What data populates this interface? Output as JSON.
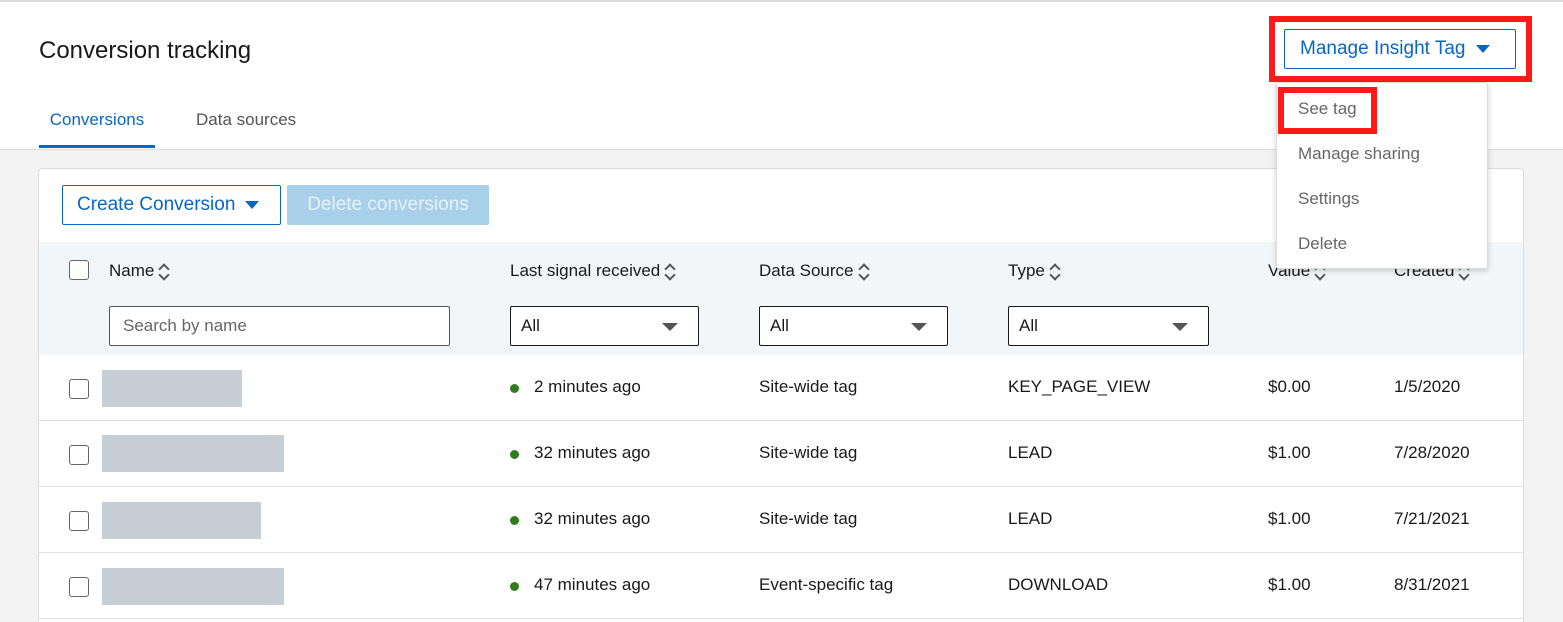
{
  "header": {
    "title": "Conversion tracking",
    "tabs": [
      {
        "label": "Conversions"
      },
      {
        "label": "Data sources"
      }
    ],
    "manage_label": "Manage Insight Tag"
  },
  "menu": {
    "items": [
      {
        "label": "See tag"
      },
      {
        "label": "Manage sharing"
      },
      {
        "label": "Settings"
      },
      {
        "label": "Delete"
      }
    ]
  },
  "toolbar": {
    "create_label": "Create Conversion",
    "delete_label": "Delete conversions"
  },
  "table": {
    "columns": [
      {
        "label": "Name"
      },
      {
        "label": "Last signal received"
      },
      {
        "label": "Data Source"
      },
      {
        "label": "Type"
      },
      {
        "label": "Value"
      },
      {
        "label": "Created"
      }
    ],
    "search_placeholder": "Search by name",
    "filters": [
      {
        "value": "All"
      },
      {
        "value": "All"
      },
      {
        "value": "All"
      }
    ],
    "rows": [
      {
        "last": "2 minutes ago",
        "source": "Site-wide tag",
        "type": "KEY_PAGE_VIEW",
        "value": "$0.00",
        "created": "1/5/2020"
      },
      {
        "last": "32 minutes ago",
        "source": "Site-wide tag",
        "type": "LEAD",
        "value": "$1.00",
        "created": "7/28/2020"
      },
      {
        "last": "32 minutes ago",
        "source": "Site-wide tag",
        "type": "LEAD",
        "value": "$1.00",
        "created": "7/21/2021"
      },
      {
        "last": "47 minutes ago",
        "source": "Event-specific tag",
        "type": "DOWNLOAD",
        "value": "$1.00",
        "created": "8/31/2021"
      }
    ]
  },
  "colors": {
    "accent": "#0a66c2",
    "highlight": "#ff1a1a",
    "status_active": "#2e7d1a"
  }
}
